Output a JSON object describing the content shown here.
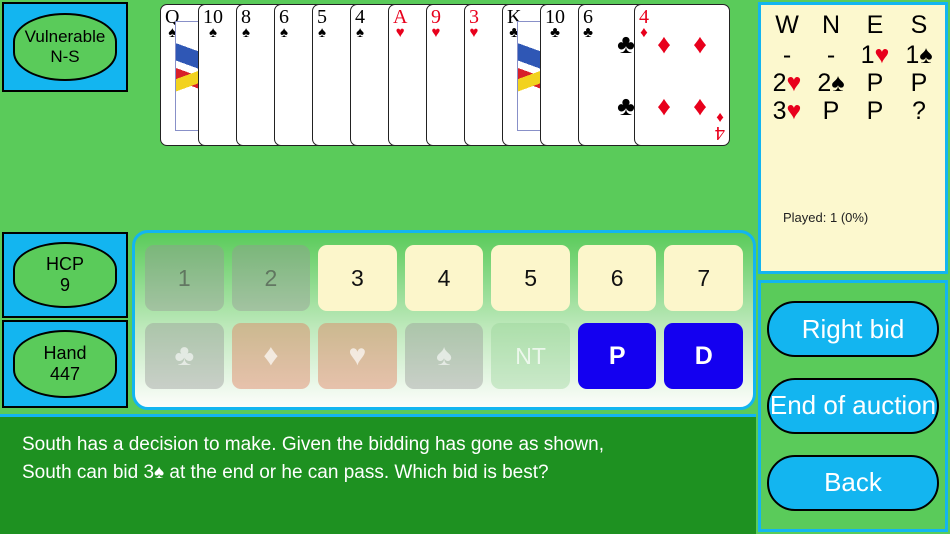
{
  "badges": {
    "vulnerable": {
      "line1": "Vulnerable",
      "line2": "N-S"
    },
    "hcp": {
      "line1": "HCP",
      "line2": "9"
    },
    "hand": {
      "line1": "Hand",
      "line2": "447"
    }
  },
  "hand": {
    "cards": [
      {
        "rank": "Q",
        "suit": "spade",
        "symbol": "♠",
        "color": "blk",
        "face": true,
        "pips": 0
      },
      {
        "rank": "10",
        "suit": "spade",
        "symbol": "♠",
        "color": "blk",
        "face": false,
        "pips": 2
      },
      {
        "rank": "8",
        "suit": "spade",
        "symbol": "♠",
        "color": "blk",
        "face": false,
        "pips": 2
      },
      {
        "rank": "6",
        "suit": "spade",
        "symbol": "♠",
        "color": "blk",
        "face": false,
        "pips": 2
      },
      {
        "rank": "5",
        "suit": "spade",
        "symbol": "♠",
        "color": "blk",
        "face": false,
        "pips": 1
      },
      {
        "rank": "4",
        "suit": "spade",
        "symbol": "♠",
        "color": "blk",
        "face": false,
        "pips": 1
      },
      {
        "rank": "A",
        "suit": "heart",
        "symbol": "♥",
        "color": "red",
        "face": false,
        "pips": 0
      },
      {
        "rank": "9",
        "suit": "heart",
        "symbol": "♥",
        "color": "red",
        "face": false,
        "pips": 3
      },
      {
        "rank": "3",
        "suit": "heart",
        "symbol": "♥",
        "color": "red",
        "face": false,
        "pips": 2
      },
      {
        "rank": "K",
        "suit": "club",
        "symbol": "♣",
        "color": "blk",
        "face": true,
        "pips": 0
      },
      {
        "rank": "10",
        "suit": "club",
        "symbol": "♣",
        "color": "blk",
        "face": false,
        "pips": 2
      },
      {
        "rank": "6",
        "suit": "club",
        "symbol": "♣",
        "color": "blk",
        "face": false,
        "pips": 2
      },
      {
        "rank": "4",
        "suit": "diamond",
        "symbol": "♦",
        "color": "red",
        "face": false,
        "pips": 2
      }
    ]
  },
  "bidbox": {
    "levels": [
      {
        "label": "1",
        "state": "disabled"
      },
      {
        "label": "2",
        "state": "disabled"
      },
      {
        "label": "3",
        "state": "active"
      },
      {
        "label": "4",
        "state": "active"
      },
      {
        "label": "5",
        "state": "active"
      },
      {
        "label": "6",
        "state": "active"
      },
      {
        "label": "7",
        "state": "active"
      }
    ],
    "denominations": [
      {
        "label": "♣",
        "name": "clubs",
        "state": "disabled",
        "style": "dclub"
      },
      {
        "label": "♦",
        "name": "diamonds",
        "state": "disabled",
        "style": "ddia"
      },
      {
        "label": "♥",
        "name": "hearts",
        "state": "disabled",
        "style": "dhrt"
      },
      {
        "label": "♠",
        "name": "spades",
        "state": "disabled",
        "style": "dspd"
      },
      {
        "label": "NT",
        "name": "notrump",
        "state": "disabled",
        "style": "dnt"
      },
      {
        "label": "P",
        "name": "pass",
        "state": "active",
        "style": "blue"
      },
      {
        "label": "D",
        "name": "double",
        "state": "active",
        "style": "blue"
      }
    ]
  },
  "message": {
    "line1": "South has a decision to make. Given the bidding has gone as shown,",
    "line2_a": "South can bid 3",
    "line2_suit": "♠",
    "line2_b": " at the end or he can pass. Which bid is best?"
  },
  "auction": {
    "headers": [
      "W",
      "N",
      "E",
      "S"
    ],
    "rows": [
      [
        {
          "level": "-",
          "suit": "",
          "color": "blk"
        },
        {
          "level": "-",
          "suit": "",
          "color": "blk"
        },
        {
          "level": "1",
          "suit": "♥",
          "color": "red"
        },
        {
          "level": "1",
          "suit": "♠",
          "color": "blk"
        }
      ],
      [
        {
          "level": "2",
          "suit": "♥",
          "color": "red"
        },
        {
          "level": "2",
          "suit": "♠",
          "color": "blk"
        },
        {
          "level": "P",
          "suit": "",
          "color": "blk"
        },
        {
          "level": "P",
          "suit": "",
          "color": "blk"
        }
      ],
      [
        {
          "level": "3",
          "suit": "♥",
          "color": "red"
        },
        {
          "level": "P",
          "suit": "",
          "color": "blk"
        },
        {
          "level": "P",
          "suit": "",
          "color": "blk"
        },
        {
          "level": "?",
          "suit": "",
          "color": "blk"
        }
      ]
    ],
    "played": "Played: 1 (0%)"
  },
  "actions": [
    {
      "label": "Right bid",
      "name": "right-bid-button"
    },
    {
      "label": "End of auction",
      "name": "end-of-auction-button"
    },
    {
      "label": "Back",
      "name": "back-button"
    }
  ],
  "colors": {
    "background_green": "#5ACB5A",
    "panel_cyan": "#13B5F0",
    "cream": "#FCF8CE",
    "message_green": "#1E9121",
    "bid_blue": "#1400F0",
    "suit_red": "#E8001C"
  }
}
